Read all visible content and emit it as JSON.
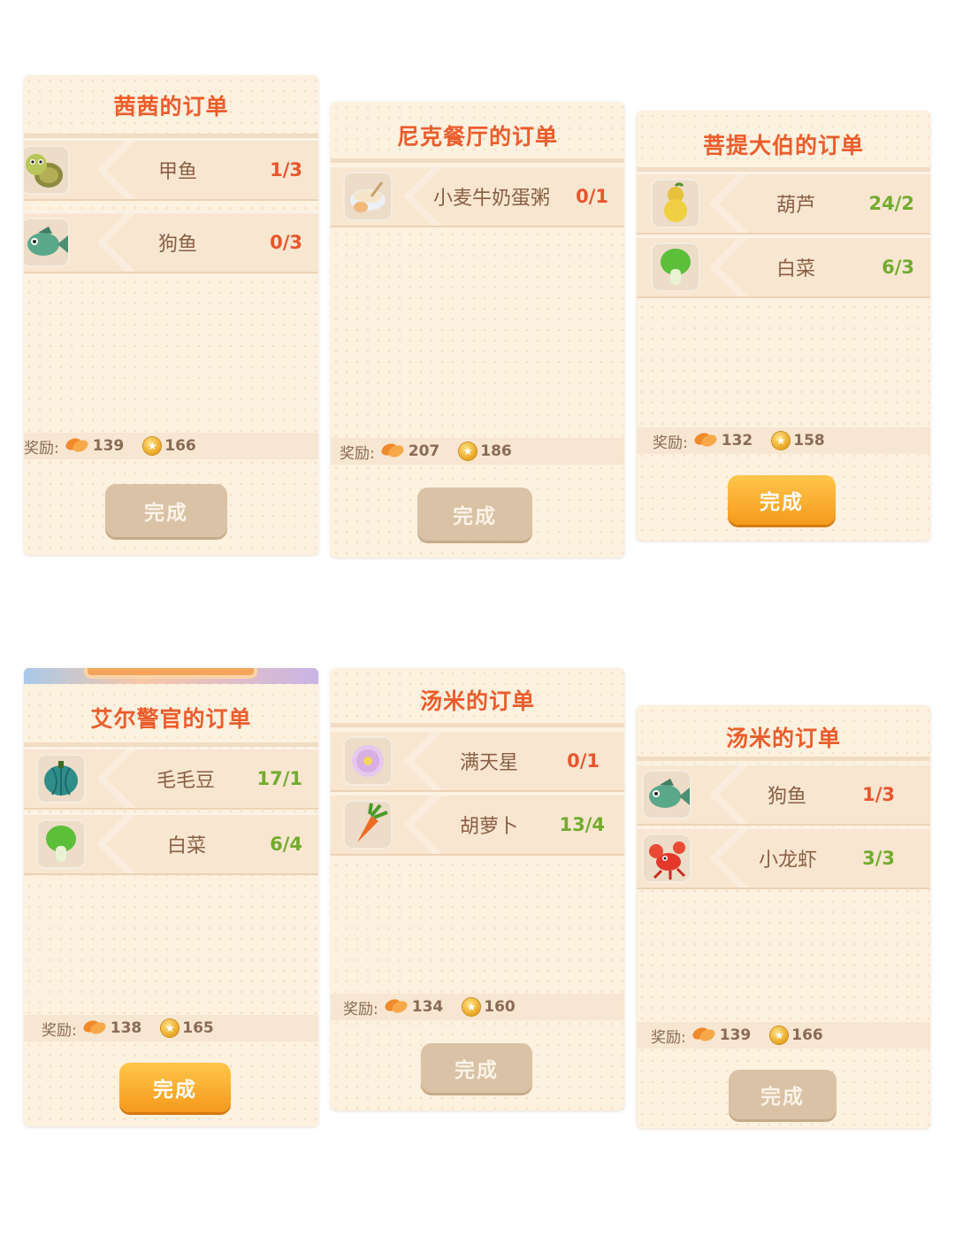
{
  "cards": [
    {
      "title": "茜茜的订单",
      "items": [
        {
          "name": "甲鱼",
          "count": "1/3",
          "icon": "turtle-icon"
        },
        {
          "name": "狗鱼",
          "count": "0/3",
          "icon": "fish-icon"
        }
      ],
      "reward_label": "奖励:",
      "reward_food": "139",
      "reward_coin": "166",
      "button": "完成"
    },
    {
      "title": "尼克餐厅的订单",
      "items": [
        {
          "name": "小麦牛奶蛋粥",
          "count": "0/1",
          "icon": "porridge-icon"
        }
      ],
      "reward_label": "奖励:",
      "reward_food": "207",
      "reward_coin": "186",
      "button": "完成"
    },
    {
      "title": "菩提大伯的订单",
      "items": [
        {
          "name": "葫芦",
          "count": "24/2",
          "icon": "gourd-icon"
        },
        {
          "name": "白菜",
          "count": "6/3",
          "icon": "bokchoy-icon"
        }
      ],
      "reward_label": "奖励:",
      "reward_food": "132",
      "reward_coin": "158",
      "button": "完成"
    },
    {
      "title": "艾尔警官的订单",
      "items": [
        {
          "name": "毛毛豆",
          "count": "17/1",
          "icon": "pumpkin-icon"
        },
        {
          "name": "白菜",
          "count": "6/4",
          "icon": "bokchoy-icon"
        }
      ],
      "reward_label": "奖励:",
      "reward_food": "138",
      "reward_coin": "165",
      "button": "完成"
    },
    {
      "title": "汤米的订单",
      "items": [
        {
          "name": "满天星",
          "count": "0/1",
          "icon": "flower-icon"
        },
        {
          "name": "胡萝卜",
          "count": "13/4",
          "icon": "carrot-icon"
        }
      ],
      "reward_label": "奖励:",
      "reward_food": "134",
      "reward_coin": "160",
      "button": "完成"
    },
    {
      "title": "汤米的订单",
      "items": [
        {
          "name": "狗鱼",
          "count": "1/3",
          "icon": "fish-icon"
        },
        {
          "name": "小龙虾",
          "count": "3/3",
          "icon": "crayfish-icon"
        }
      ],
      "reward_label": "奖励:",
      "reward_food": "139",
      "reward_coin": "166",
      "button": "完成"
    }
  ],
  "colors": {
    "title": "#ec5d2b",
    "count_incomplete": "#e8552e",
    "count_complete": "#72ac2f",
    "button_active": "#f59a1d",
    "button_inactive": "#d9c2a5"
  }
}
